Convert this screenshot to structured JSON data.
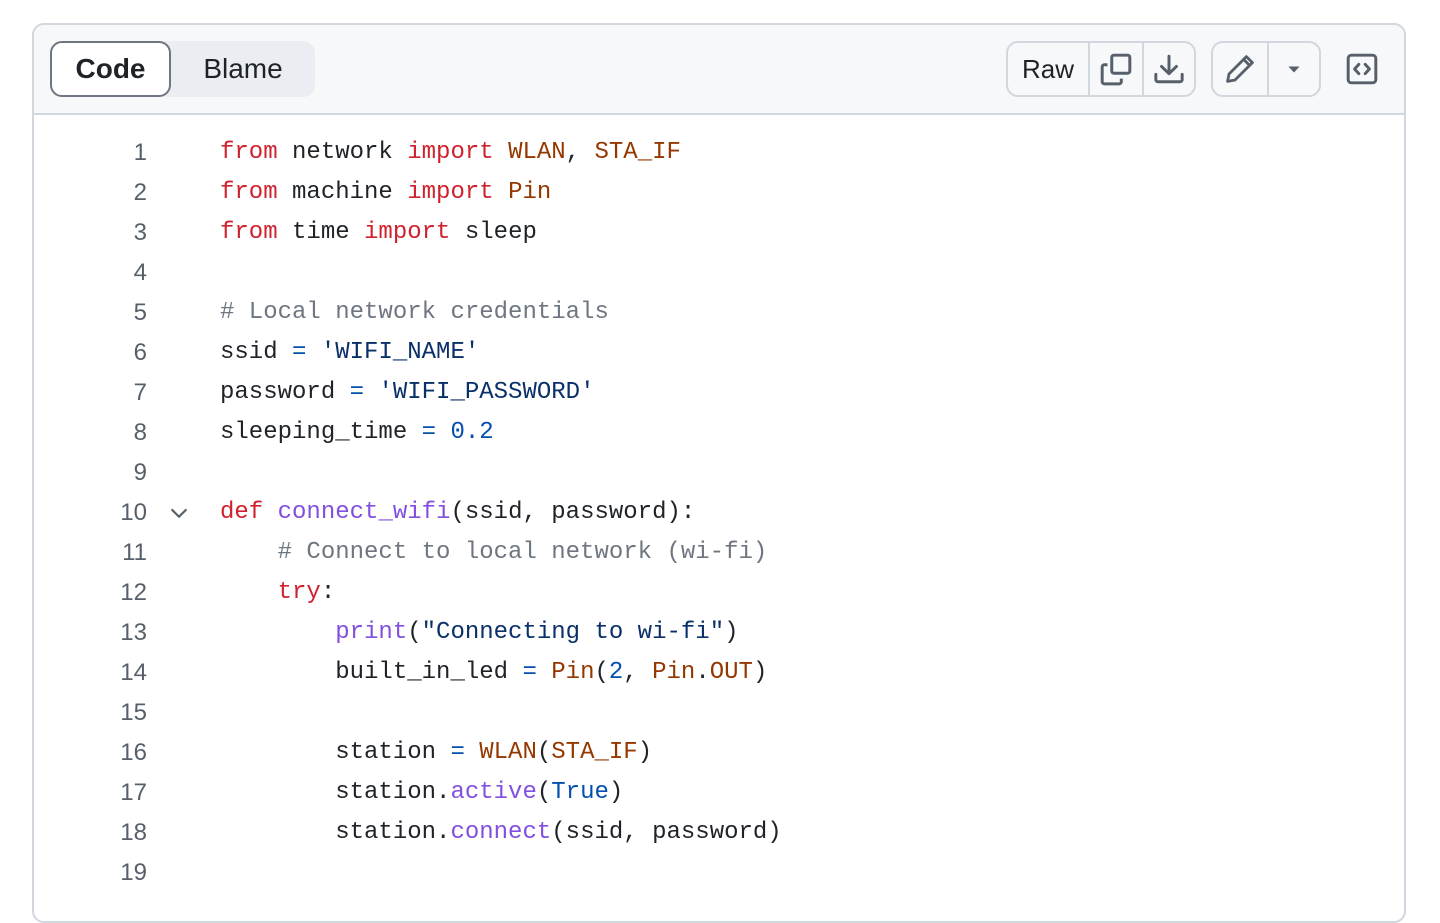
{
  "toolbar": {
    "tabs": [
      {
        "label": "Code",
        "selected": true
      },
      {
        "label": "Blame",
        "selected": false
      }
    ],
    "raw_label": "Raw",
    "icons": [
      "copy-icon",
      "download-icon",
      "pencil-icon",
      "triangle-down-icon",
      "code-square-icon"
    ]
  },
  "colors": {
    "keyword": "#cf222e",
    "comment": "#6e7781",
    "string": "#0a3069",
    "number": "#0550ae",
    "function": "#8250df",
    "builtin": "#953800",
    "plain": "#1f2328",
    "line_number": "#57606a"
  },
  "code": {
    "lines": [
      {
        "n": "1",
        "tokens": [
          [
            "k",
            "from"
          ],
          [
            "p",
            " network "
          ],
          [
            "k",
            "import"
          ],
          [
            "p",
            " "
          ],
          [
            "b",
            "WLAN"
          ],
          [
            "p",
            ", "
          ],
          [
            "b",
            "STA_IF"
          ]
        ]
      },
      {
        "n": "2",
        "tokens": [
          [
            "k",
            "from"
          ],
          [
            "p",
            " machine "
          ],
          [
            "k",
            "import"
          ],
          [
            "p",
            " "
          ],
          [
            "b",
            "Pin"
          ]
        ]
      },
      {
        "n": "3",
        "tokens": [
          [
            "k",
            "from"
          ],
          [
            "p",
            " time "
          ],
          [
            "k",
            "import"
          ],
          [
            "p",
            " sleep"
          ]
        ]
      },
      {
        "n": "4",
        "tokens": []
      },
      {
        "n": "5",
        "tokens": [
          [
            "c",
            "# Local network credentials"
          ]
        ]
      },
      {
        "n": "6",
        "tokens": [
          [
            "p",
            "ssid "
          ],
          [
            "n",
            "="
          ],
          [
            "p",
            " "
          ],
          [
            "s",
            "'WIFI_NAME'"
          ]
        ]
      },
      {
        "n": "7",
        "tokens": [
          [
            "p",
            "password "
          ],
          [
            "n",
            "="
          ],
          [
            "p",
            " "
          ],
          [
            "s",
            "'WIFI_PASSWORD'"
          ]
        ]
      },
      {
        "n": "8",
        "tokens": [
          [
            "p",
            "sleeping_time "
          ],
          [
            "n",
            "="
          ],
          [
            "p",
            " "
          ],
          [
            "n",
            "0.2"
          ]
        ]
      },
      {
        "n": "9",
        "tokens": []
      },
      {
        "n": "10",
        "fold": true,
        "tokens": [
          [
            "k",
            "def"
          ],
          [
            "p",
            " "
          ],
          [
            "f",
            "connect_wifi"
          ],
          [
            "p",
            "(ssid, password):"
          ]
        ]
      },
      {
        "n": "11",
        "tokens": [
          [
            "p",
            "    "
          ],
          [
            "c",
            "# Connect to local network (wi-fi)"
          ]
        ]
      },
      {
        "n": "12",
        "tokens": [
          [
            "p",
            "    "
          ],
          [
            "k",
            "try"
          ],
          [
            "p",
            ":"
          ]
        ]
      },
      {
        "n": "13",
        "tokens": [
          [
            "p",
            "        "
          ],
          [
            "f",
            "print"
          ],
          [
            "p",
            "("
          ],
          [
            "s",
            "\"Connecting to wi-fi\""
          ],
          [
            "p",
            ")"
          ]
        ]
      },
      {
        "n": "14",
        "tokens": [
          [
            "p",
            "        built_in_led "
          ],
          [
            "n",
            "="
          ],
          [
            "p",
            " "
          ],
          [
            "b",
            "Pin"
          ],
          [
            "p",
            "("
          ],
          [
            "n",
            "2"
          ],
          [
            "p",
            ", "
          ],
          [
            "b",
            "Pin"
          ],
          [
            "p",
            "."
          ],
          [
            "b",
            "OUT"
          ],
          [
            "p",
            ")"
          ]
        ]
      },
      {
        "n": "15",
        "tokens": []
      },
      {
        "n": "16",
        "tokens": [
          [
            "p",
            "        station "
          ],
          [
            "n",
            "="
          ],
          [
            "p",
            " "
          ],
          [
            "b",
            "WLAN"
          ],
          [
            "p",
            "("
          ],
          [
            "b",
            "STA_IF"
          ],
          [
            "p",
            ")"
          ]
        ]
      },
      {
        "n": "17",
        "tokens": [
          [
            "p",
            "        station."
          ],
          [
            "f",
            "active"
          ],
          [
            "p",
            "("
          ],
          [
            "n",
            "True"
          ],
          [
            "p",
            ")"
          ]
        ]
      },
      {
        "n": "18",
        "tokens": [
          [
            "p",
            "        station."
          ],
          [
            "f",
            "connect"
          ],
          [
            "p",
            "(ssid, password)"
          ]
        ]
      },
      {
        "n": "19",
        "tokens": []
      }
    ]
  }
}
